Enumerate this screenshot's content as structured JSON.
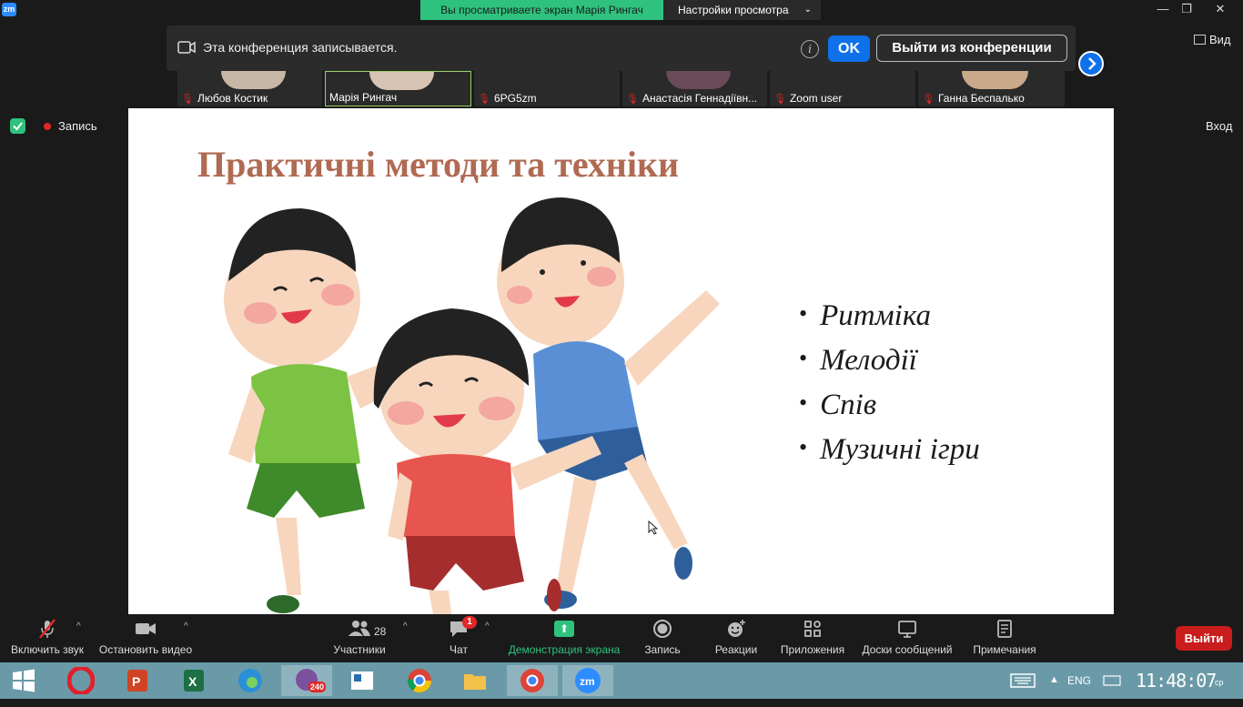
{
  "titlebar": {
    "logo": "zm",
    "share_banner": "Вы просматриваете экран Марія Рингач",
    "view_settings": "Настройки просмотра",
    "controls": {
      "minimize": "—",
      "restore": "❐",
      "close": "✕"
    }
  },
  "notice": {
    "text": "Эта конференция записывается.",
    "info": "i",
    "ok": "OK",
    "leave": "Выйти из конференции"
  },
  "view_button": "Вид",
  "participants": [
    {
      "name": "Любов Костик",
      "muted": true
    },
    {
      "name": "Марія Рингач",
      "muted": false
    },
    {
      "name": "6PG5zm",
      "muted": true
    },
    {
      "name": "Анастасія Геннадіївн...",
      "muted": true
    },
    {
      "name": "Zoom user",
      "muted": true
    },
    {
      "name": "Ганна Беспалько",
      "muted": true
    }
  ],
  "recording_status": "Запись",
  "enter_button": "Вход",
  "slide": {
    "title": "Практичні методи та техніки",
    "bullets": [
      "Ритміка",
      "Мелодії",
      "Спів",
      "Музичні ігри"
    ]
  },
  "toolbar": {
    "unmute": "Включить звук",
    "stop_video": "Остановить видео",
    "participants": "Участники",
    "participants_count": "28",
    "chat": "Чат",
    "chat_badge": "1",
    "share": "Демонстрация экрана",
    "record": "Запись",
    "reactions": "Реакции",
    "apps": "Приложения",
    "whiteboards": "Доски сообщений",
    "notes": "Примечания",
    "leave": "Выйти"
  },
  "taskbar": {
    "viber_badge": "240",
    "lang": "ENG",
    "time": "11:48:07",
    "day": "ср"
  },
  "colors": {
    "accent_blue": "#0e71eb",
    "share_green": "#2ec27e",
    "leave_red": "#c91d1d",
    "slide_title": "#b06a52"
  }
}
